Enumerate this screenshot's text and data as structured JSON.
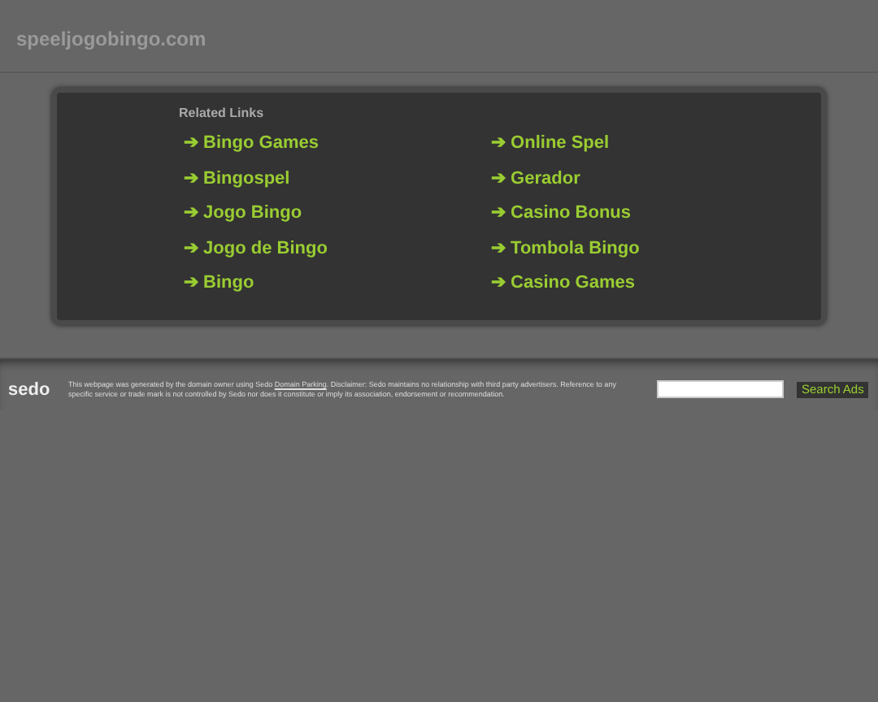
{
  "site_title": "speeljogobingo.com",
  "related": {
    "heading": "Related Links",
    "columns": [
      [
        "➔ Bingo Games",
        "➔ Bingospel",
        "➔ Jogo Bingo",
        "➔ Jogo de Bingo",
        "➔ Bingo"
      ],
      [
        "➔ Online Spel",
        "➔ Gerador",
        "➔ Casino Bonus",
        "➔ Tombola Bingo",
        "➔ Casino Games"
      ]
    ]
  },
  "footer": {
    "logo": "sedo",
    "disclaimer_before": "This webpage was generated by the domain owner using Sedo ",
    "disclaimer_link": "Domain Parking",
    "disclaimer_after": ". Disclaimer: Sedo maintains no relationship with third party advertisers. Reference to any specific service or trade mark is not controlled by Sedo nor does it constitute or imply its association, endorsement or recommendation.",
    "search_button": "Search Ads"
  }
}
